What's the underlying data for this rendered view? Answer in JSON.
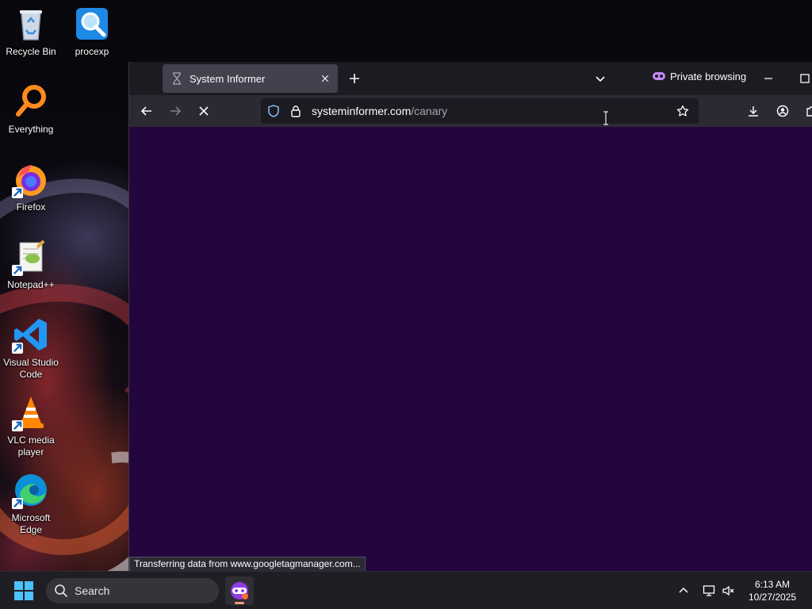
{
  "desktop": {
    "icons": [
      {
        "label": "Recycle Bin",
        "icon": "recycle-bin-icon"
      },
      {
        "label": "procexp",
        "icon": "process-explorer-icon"
      },
      {
        "label": "Everything",
        "icon": "everything-search-icon"
      },
      {
        "label": "Firefox",
        "icon": "firefox-icon"
      },
      {
        "label": "Notepad++",
        "icon": "notepad-plus-plus-icon"
      },
      {
        "label": "Visual Studio Code",
        "icon": "vscode-icon"
      },
      {
        "label": "VLC media player",
        "icon": "vlc-icon"
      },
      {
        "label": "Microsoft Edge",
        "icon": "edge-icon"
      }
    ]
  },
  "browser": {
    "tab": {
      "title": "System Informer",
      "favicon": "hourglass-icon"
    },
    "private_label": "Private browsing",
    "url": {
      "host": "systeminformer.com",
      "path": "/canary"
    },
    "status_text": "Transferring data from www.googletagmanager.com...",
    "colors": {
      "content_bg": "#24063e",
      "chrome_bg": "#1c1b22",
      "toolbar_bg": "#2b2a33",
      "tab_bg": "#42414d"
    }
  },
  "taskbar": {
    "search_placeholder": "Search",
    "time": "6:13 AM",
    "date": "10/27/2025",
    "running_app": "firefox-private-icon"
  }
}
